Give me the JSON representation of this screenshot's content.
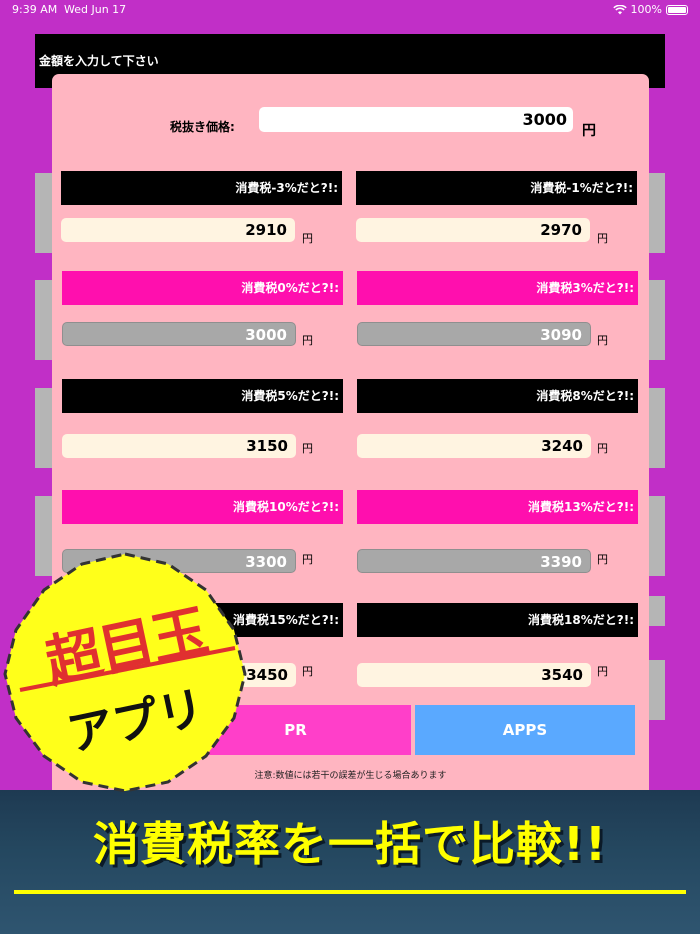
{
  "status_bar": {
    "time": "9:39 AM",
    "date": "Wed Jun 17",
    "battery": "100%"
  },
  "header": {
    "instruction": "金額を入力して下さい"
  },
  "price": {
    "label": "税抜き価格:",
    "value": "3000",
    "unit": "円"
  },
  "rates": [
    {
      "header": "消費税-3%だと?!:",
      "value": "2910",
      "unit": "円"
    },
    {
      "header": "消費税-1%だと?!:",
      "value": "2970",
      "unit": "円"
    },
    {
      "header": "消費税0%だと?!:",
      "value": "3000",
      "unit": "円"
    },
    {
      "header": "消費税3%だと?!:",
      "value": "3090",
      "unit": "円"
    },
    {
      "header": "消費税5%だと?!:",
      "value": "3150",
      "unit": "円"
    },
    {
      "header": "消費税8%だと?!:",
      "value": "3240",
      "unit": "円"
    },
    {
      "header": "消費税10%だと?!:",
      "value": "3300",
      "unit": "円"
    },
    {
      "header": "消費税13%だと?!:",
      "value": "3390",
      "unit": "円"
    },
    {
      "header": "消費税15%だと?!:",
      "value": "3450",
      "unit": "円"
    },
    {
      "header": "消費税18%だと?!:",
      "value": "3540",
      "unit": "円"
    }
  ],
  "buttons": {
    "pr": "PR",
    "apps": "APPS"
  },
  "notice": "注意:数値には若干の誤差が生じる場合あります",
  "badge": {
    "top": "超目玉",
    "bottom": "アプリ"
  },
  "banner": {
    "text": "消費税率を一括で比較!!"
  },
  "colors": {
    "background": "#c12fc7",
    "panel": "#ffb5c1",
    "pink_header": "#ff0fae",
    "banner_text": "#ffff00"
  }
}
